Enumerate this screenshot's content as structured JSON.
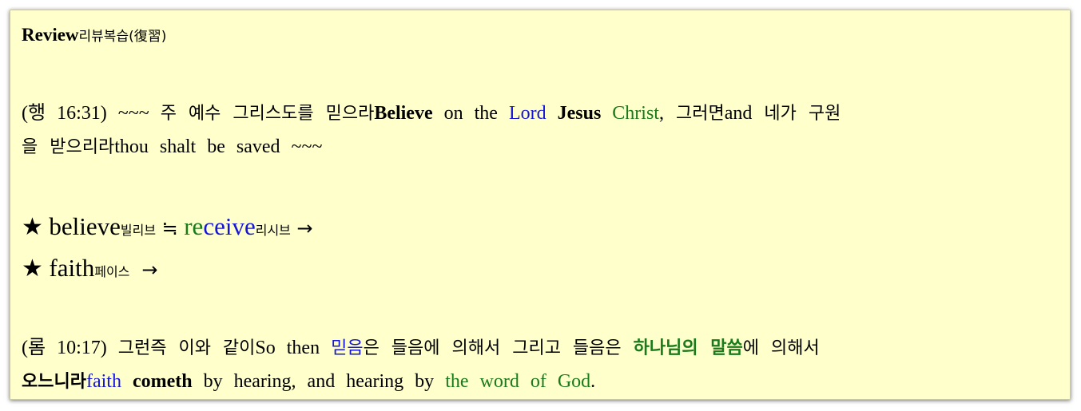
{
  "title": {
    "en": "Review",
    "ko": "리뷰복습(復習)"
  },
  "verse1": {
    "ref": "(행 16:31) ~~~ ",
    "ko1": "주 예수 그리스도를 믿으라",
    "en_believe": "Believe",
    "en_on_the": " on the ",
    "en_lord": "Lord",
    "en_jesus": "Jesus",
    "en_christ": "Christ",
    "comma": ",",
    "ko2": " 그러면",
    "en_and": "and",
    "ko3": " 네가 구원",
    "ko4": "을 받으리라",
    "en_rest": "thou shalt be saved ~~~"
  },
  "star_lines": [
    {
      "star": "★",
      "word": "believe",
      "pron": "빌리브",
      "approx": "≒",
      "rel_re": "re",
      "rel_ceive": "ceive",
      "rel_pron": "리시브",
      "arrow": "→"
    },
    {
      "star": "★",
      "word": "faith",
      "pron": "페이스",
      "arrow": "→"
    }
  ],
  "verse2": {
    "ref": "(롬 10:17) ",
    "ko1": "그런즉 이와 같이",
    "en_so_then": "So then ",
    "ko_faith": "믿음",
    "ko2": "은 들음에 의해서 그리고 들음은 ",
    "ko_word": "하나님의 말씀",
    "ko3": "에 의해서",
    "ko4": "오느니라",
    "en_faith": "faith",
    "en_cometh": "cometh",
    "en_mid": " by hearing, and hearing by ",
    "en_word": "the word of God",
    "period": "."
  },
  "colors": {
    "background": "#ffffcc",
    "blue": "#1515d6",
    "green": "#1a7a1a"
  }
}
